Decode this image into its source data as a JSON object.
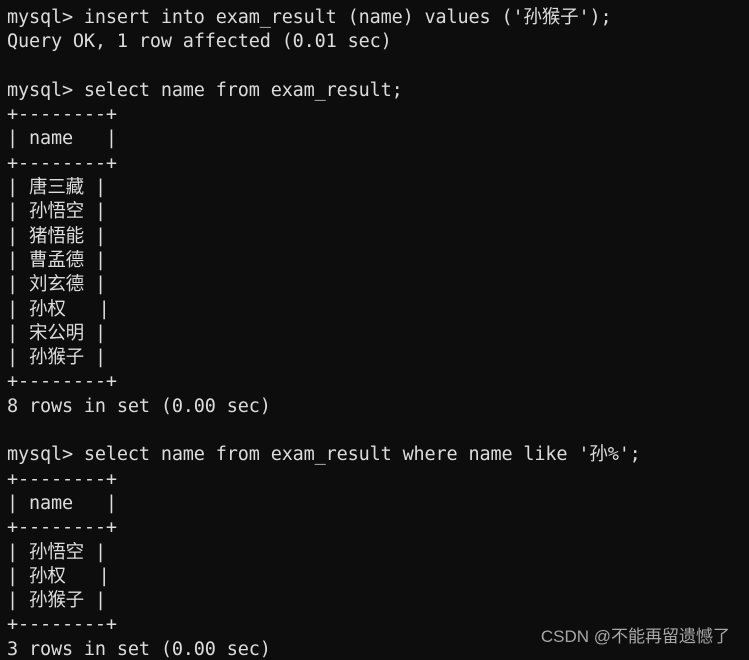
{
  "terminal": {
    "background_color": "#0d0d0d",
    "foreground_color": "#dcdcdc",
    "prompt": "mysql> ",
    "columns": 50,
    "lines": [
      "mysql> insert into exam_result (name) values ('孙猴子');",
      "Query OK, 1 row affected (0.01 sec)",
      "",
      "mysql> select name from exam_result;",
      "+--------+",
      "| name   |",
      "+--------+",
      "| 唐三藏 |",
      "| 孙悟空 |",
      "| 猪悟能 |",
      "| 曹孟德 |",
      "| 刘玄德 |",
      "| 孙权   |",
      "| 宋公明 |",
      "| 孙猴子 |",
      "+--------+",
      "8 rows in set (0.00 sec)",
      "",
      "mysql> select name from exam_result where name like '孙%';",
      "+--------+",
      "| name   |",
      "+--------+",
      "| 孙悟空 |",
      "| 孙权   |",
      "| 孙猴子 |",
      "+--------+",
      "3 rows in set (0.00 sec)"
    ],
    "commands": [
      {
        "prompt": "mysql>",
        "sql": "insert into exam_result (name) values ('孙猴子');",
        "status": "Query OK, 1 row affected (0.01 sec)"
      },
      {
        "prompt": "mysql>",
        "sql": "select name from exam_result;",
        "columns": [
          "name"
        ],
        "rows": [
          [
            "唐三藏"
          ],
          [
            "孙悟空"
          ],
          [
            "猪悟能"
          ],
          [
            "曹孟德"
          ],
          [
            "刘玄德"
          ],
          [
            "孙权"
          ],
          [
            "宋公明"
          ],
          [
            "孙猴子"
          ]
        ],
        "status": "8 rows in set (0.00 sec)"
      },
      {
        "prompt": "mysql>",
        "sql": "select name from exam_result where name like '孙%';",
        "columns": [
          "name"
        ],
        "rows": [
          [
            "孙悟空"
          ],
          [
            "孙权"
          ],
          [
            "孙猴子"
          ]
        ],
        "status": "3 rows in set (0.00 sec)"
      }
    ]
  },
  "watermark": {
    "text": "CSDN @不能再留遗憾了",
    "color": "#b5b5b5"
  }
}
